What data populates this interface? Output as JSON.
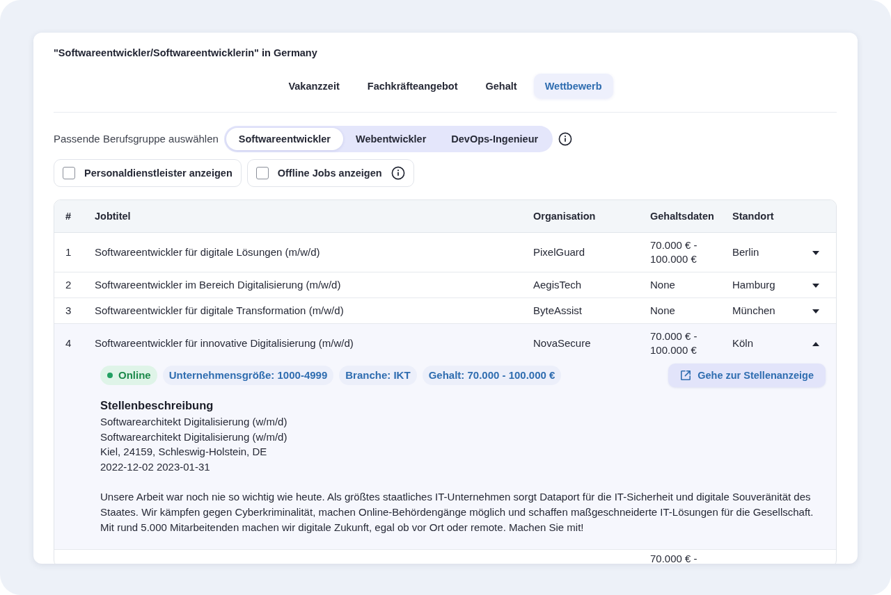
{
  "header": {
    "title": "\"Softwareentwickler/Softwareentwicklerin\" in Germany"
  },
  "tabs": [
    {
      "label": "Vakanzzeit",
      "selected": false
    },
    {
      "label": "Fachkräfteangebot",
      "selected": false
    },
    {
      "label": "Gehalt",
      "selected": false
    },
    {
      "label": "Wettbewerb",
      "selected": true
    }
  ],
  "occupation_picker": {
    "label": "Passende Berufsgruppe auswählen",
    "options": [
      {
        "label": "Softwareentwickler",
        "selected": true
      },
      {
        "label": "Webentwickler",
        "selected": false
      },
      {
        "label": "DevOps-Ingenieur",
        "selected": false
      }
    ],
    "info": true
  },
  "filters": [
    {
      "label": "Personaldienstleister anzeigen",
      "checked": false,
      "info": false
    },
    {
      "label": "Offline Jobs anzeigen",
      "checked": false,
      "info": true
    }
  ],
  "table": {
    "columns": [
      "#",
      "Jobtitel",
      "Organisation",
      "Gehaltsdaten",
      "Standort"
    ],
    "rows": [
      {
        "number": "1",
        "title": "Softwareentwickler für digitale Lösungen (m/w/d)",
        "organisation": "PixelGuard",
        "salary": "70.000 € - 100.000 €",
        "location": "Berlin",
        "expanded": false
      },
      {
        "number": "2",
        "title": "Softwareentwickler im Bereich Digitalisierung (m/w/d)",
        "organisation": "AegisTech",
        "salary": "None",
        "location": "Hamburg",
        "expanded": false
      },
      {
        "number": "3",
        "title": "Softwareentwickler für digitale Transformation (m/w/d)",
        "organisation": "ByteAssist",
        "salary": "None",
        "location": "München",
        "expanded": false
      },
      {
        "number": "4",
        "title": "Softwareentwickler für innovative Digitalisierung (m/w/d)",
        "organisation": "NovaSecure",
        "salary": "70.000 € - 100.000 €",
        "location": "Köln",
        "expanded": true,
        "details": {
          "tags": [
            {
              "kind": "status",
              "label": "Online",
              "color": "#22a062"
            },
            {
              "kind": "tag",
              "label": "Unternehmensgröße: 1000-4999"
            },
            {
              "kind": "tag",
              "label": "Branche: IKT"
            },
            {
              "kind": "tag",
              "label": "Gehalt: 70.000 - 100.000 €"
            }
          ],
          "link_button": "Gehe zur Stellenanzeige",
          "heading": "Stellenbeschreibung",
          "lines": [
            "Softwarearchitekt Digitalisierung (w/m/d)",
            "Softwarearchitekt Digitalisierung (w/m/d)",
            "Kiel, 24159, Schleswig-Holstein, DE",
            "2022-12-02 2023-01-31"
          ],
          "text": "Unsere Arbeit war noch nie so wichtig wie heute. Als größtes staatliches IT-Unternehmen sorgt Dataport für die IT-Sicherheit und digitale Souveränität des Staates. Wir kämpfen gegen Cyberkriminalität, machen Online-Behördengänge möglich und schaffen maßgeschneiderte IT-Lösungen für die Gesellschaft. Mit rund 5.000 Mitarbeitenden machen wir digitale Zukunft, egal ob vor Ort oder remote. Machen Sie mit!"
        }
      },
      {
        "salary": "70.000 € -"
      }
    ]
  }
}
